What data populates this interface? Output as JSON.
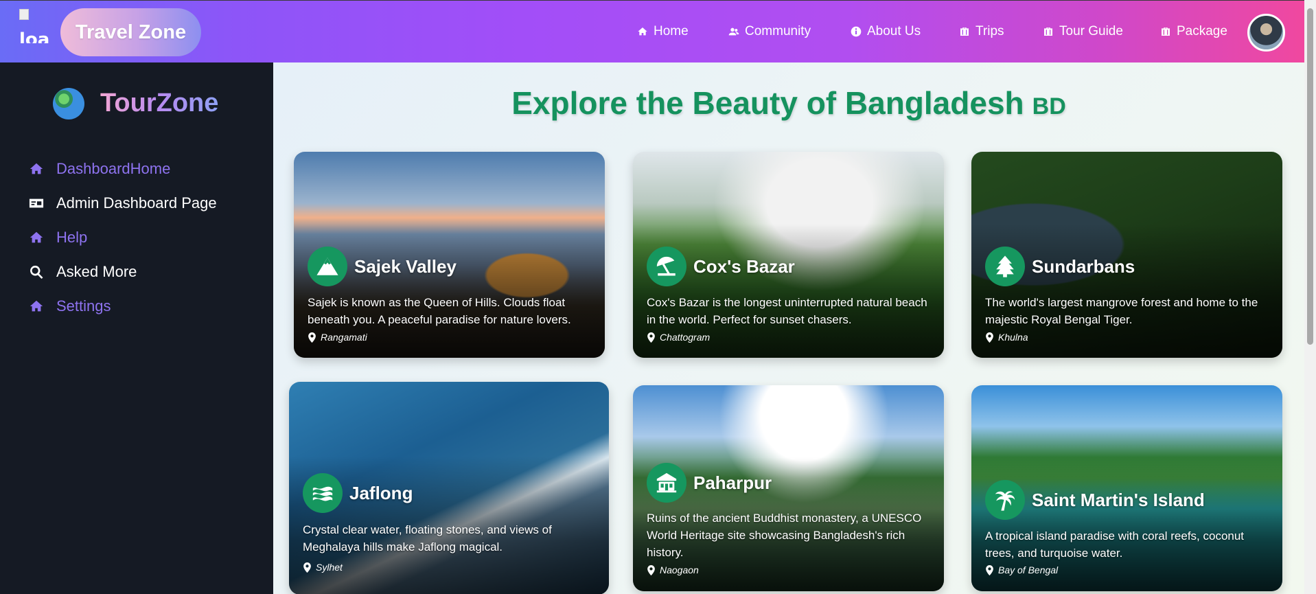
{
  "topbar": {
    "logo_alt": "loa",
    "brand": "Travel Zone",
    "nav": [
      {
        "label": "Home",
        "icon": "home-icon"
      },
      {
        "label": "Community",
        "icon": "users-icon"
      },
      {
        "label": "About Us",
        "icon": "info-icon"
      },
      {
        "label": "Trips",
        "icon": "briefcase-icon"
      },
      {
        "label": "Tour Guide",
        "icon": "briefcase-icon"
      },
      {
        "label": "Package",
        "icon": "briefcase-icon"
      }
    ]
  },
  "sidebar": {
    "brand": "TourZone",
    "items": [
      {
        "label": "DashboardHome",
        "icon": "home-icon"
      },
      {
        "label": "Admin Dashboard Page",
        "icon": "id-card-icon"
      },
      {
        "label": "Help",
        "icon": "home-icon"
      },
      {
        "label": "Asked More",
        "icon": "search-icon"
      },
      {
        "label": "Settings",
        "icon": "home-icon"
      }
    ]
  },
  "main": {
    "title": "Explore the Beauty of Bangladesh",
    "flag": "BD",
    "cards": [
      {
        "name": "Sajek Valley",
        "icon": "mountain-icon",
        "desc": "Sajek is known as the Queen of Hills. Clouds float beneath you. A peaceful paradise for nature lovers.",
        "location": "Rangamati"
      },
      {
        "name": "Cox's Bazar",
        "icon": "umbrella-beach-icon",
        "desc": "Cox's Bazar is the longest uninterrupted natural beach in the world. Perfect for sunset chasers.",
        "location": "Chattogram"
      },
      {
        "name": "Sundarbans",
        "icon": "tree-icon",
        "desc": "The world's largest mangrove forest and home to the majestic Royal Bengal Tiger.",
        "location": "Khulna"
      },
      {
        "name": "Jaflong",
        "icon": "water-icon",
        "desc": "Crystal clear water, floating stones, and views of Meghalaya hills make Jaflong magical.",
        "location": "Sylhet"
      },
      {
        "name": "Paharpur",
        "icon": "landmark-icon",
        "desc": "Ruins of the ancient Buddhist monastery, a UNESCO World Heritage site showcasing Bangladesh's rich history.",
        "location": "Naogaon"
      },
      {
        "name": "Saint Martin's Island",
        "icon": "palm-tree-icon",
        "desc": "A tropical island paradise with coral reefs, coconut trees, and turquoise water.",
        "location": "Bay of Bengal"
      }
    ]
  },
  "colors": {
    "accent_green": "#16975f",
    "sidebar_purple": "#8e73f0",
    "sidebar_bg": "#151a24"
  }
}
